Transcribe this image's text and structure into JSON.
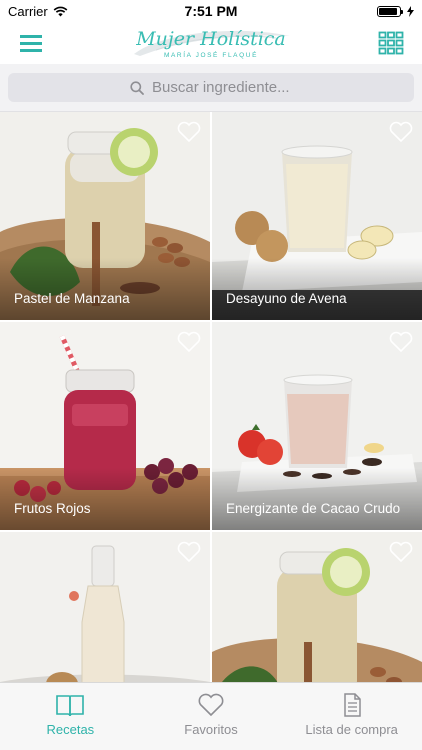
{
  "status_bar": {
    "carrier": "Carrier",
    "time": "7:51 PM",
    "battery_level": 0.9
  },
  "header": {
    "logo_title": "Mujer Holística",
    "logo_subtitle": "MARÍA JOSÉ FLAQUÉ",
    "menu_icon": "hamburger-icon",
    "grid_icon": "grid-icon",
    "accent_color": "#2fb3aa"
  },
  "search": {
    "placeholder": "Buscar ingrediente..."
  },
  "recipes": [
    {
      "title": "Pastel de Manzana",
      "favorite": false
    },
    {
      "title": "Desayuno de Avena",
      "favorite": false
    },
    {
      "title": "Frutos Rojos",
      "favorite": false
    },
    {
      "title": "Energizante de Cacao Crudo",
      "favorite": false
    },
    {
      "title": "",
      "favorite": false
    },
    {
      "title": "",
      "favorite": false
    }
  ],
  "tabs": [
    {
      "label": "Recetas",
      "icon": "book-icon",
      "active": true
    },
    {
      "label": "Favoritos",
      "icon": "heart-icon",
      "active": false
    },
    {
      "label": "Lista de compra",
      "icon": "list-icon",
      "active": false
    }
  ]
}
